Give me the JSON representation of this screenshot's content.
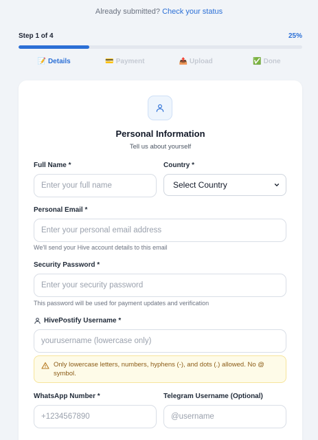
{
  "header": {
    "already_text": "Already submitted?",
    "status_link": "Check your status"
  },
  "progress": {
    "step_label": "Step 1 of 4",
    "percent_label": "25%",
    "value": 0.25
  },
  "steps": [
    {
      "emoji": "📝",
      "label": "Details"
    },
    {
      "emoji": "💳",
      "label": "Payment"
    },
    {
      "emoji": "📤",
      "label": "Upload"
    },
    {
      "emoji": "✅",
      "label": "Done"
    }
  ],
  "card": {
    "title": "Personal Information",
    "subtitle": "Tell us about yourself"
  },
  "fields": {
    "full_name": {
      "label": "Full Name *",
      "placeholder": "Enter your full name"
    },
    "country": {
      "label": "Country *",
      "value": "Select Country"
    },
    "email": {
      "label": "Personal Email *",
      "placeholder": "Enter your personal email address",
      "hint": "We'll send your Hive account details to this email"
    },
    "password": {
      "label": "Security Password *",
      "placeholder": "Enter your security password",
      "hint": "This password will be used for payment updates and verification"
    },
    "username": {
      "label": "HivePostify Username *",
      "placeholder": "yourusername (lowercase only)",
      "warning": "Only lowercase letters, numbers, hyphens (-), and dots (.) allowed. No @ symbol."
    },
    "whatsapp": {
      "label": "WhatsApp Number *",
      "placeholder": "+1234567890"
    },
    "telegram": {
      "label": "Telegram Username (Optional)",
      "placeholder": "@username"
    }
  },
  "colors": {
    "accent": "#2b6fd6",
    "warning_bg": "#fefbe8",
    "warning_text": "#8a5a14"
  }
}
